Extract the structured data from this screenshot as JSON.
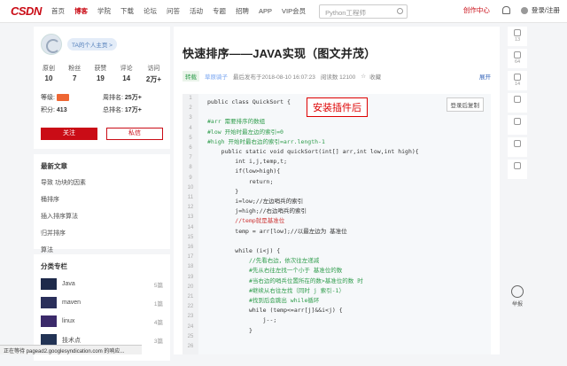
{
  "header": {
    "logo": "CSDN",
    "nav": [
      "首页",
      "博客",
      "学院",
      "下载",
      "论坛",
      "问答",
      "活动",
      "专题",
      "招聘",
      "APP",
      "VIP会员"
    ],
    "active_index": 1,
    "search_placeholder": "Python工程师",
    "create_label": "创作中心",
    "login_label": "登录/注册",
    "accent": "#ca0c16"
  },
  "profile": {
    "username": "TA的个人主页 >",
    "stats": [
      {
        "label": "原创",
        "value": "10"
      },
      {
        "label": "粉丝",
        "value": "7"
      },
      {
        "label": "获赞",
        "value": "19"
      },
      {
        "label": "评论",
        "value": "14"
      },
      {
        "label": "访问",
        "value": "2万+"
      }
    ],
    "level_label": "等级:",
    "rank_label": "周排名:",
    "rank_value": "25万+",
    "points_label": "积分:",
    "points_value": "413",
    "total_rank_label": "总排名:",
    "total_rank_value": "17万+",
    "follow_label": "关注",
    "message_label": "私信"
  },
  "latest": {
    "title": "最新文章",
    "items": [
      "导致 功块的因素",
      "桶排序",
      "插入排序算法",
      "归并排序",
      "算法"
    ]
  },
  "columns": {
    "title": "分类专栏",
    "items": [
      {
        "name": "Java",
        "count": "5篇",
        "color": "#1e2a4a"
      },
      {
        "name": "maven",
        "count": "1篇",
        "color": "#2a2f5a"
      },
      {
        "name": "linux",
        "count": "4篇",
        "color": "#3b2a6a"
      },
      {
        "name": "技术点",
        "count": "3篇",
        "color": "#223355"
      }
    ]
  },
  "article": {
    "title": "快速排序——JAVA实现（图文并茂）",
    "tag": "转载",
    "author": "草原骑子",
    "published": "最后发布于2018-08-10 16:07:23",
    "reads": "阅读数 12100",
    "favorite": "收藏",
    "expand": "展开",
    "copy_label": "登录后复制",
    "plugin_label": "安装插件后",
    "line_numbers": [
      "1",
      "2",
      "3",
      "4",
      "5",
      "6",
      "7",
      "8",
      "9",
      "10",
      "11",
      "12",
      "13",
      "14",
      "15",
      "16",
      "17",
      "18",
      "19",
      "20",
      "21",
      "22",
      "23",
      "24",
      "25",
      "26"
    ],
    "code_lines": [
      "public class QuickSort {",
      "",
      "#arr 需要排序的数组",
      "#low 开始时最左边的索引=0",
      "#high 开始时最右边的索引=arr.length-1",
      "    public static void quickSort(int[] arr,int low,int high){",
      "        int i,j,temp,t;",
      "        if(low>high){",
      "            return;",
      "        }",
      "        i=low;//左边哨兵的索引",
      "        j=high;//右边哨兵的索引",
      "        //temp就是基准位",
      "        temp = arr[low];//以最左边为 基准位",
      "",
      "        while (i<j) {",
      "            //先看右边，依次往左递减",
      "            #先从右往左找一个小于 基准位的数",
      "            #当右边的哨兵位置所在的数>基准位的数 时",
      "            #继续从右往左找（同时 j 索引-1）",
      "            #找到后会跳出 while循环",
      "            while (temp<=arr[j]&&i<j) {",
      "                j--;",
      "            }",
      ""
    ]
  },
  "right_tools": [
    {
      "icon": "like-icon",
      "count": "13"
    },
    {
      "icon": "favorite-icon",
      "count": "64"
    },
    {
      "icon": "comment-icon",
      "count": "14"
    },
    {
      "icon": "share-icon",
      "count": ""
    },
    {
      "icon": "app-icon",
      "count": ""
    },
    {
      "icon": "collapse-icon",
      "count": ""
    },
    {
      "icon": "more-icon",
      "count": ""
    }
  ],
  "tip_label": "举报",
  "statusbar": "正在等待 pagead2.googlesyndication.com 的响应..."
}
